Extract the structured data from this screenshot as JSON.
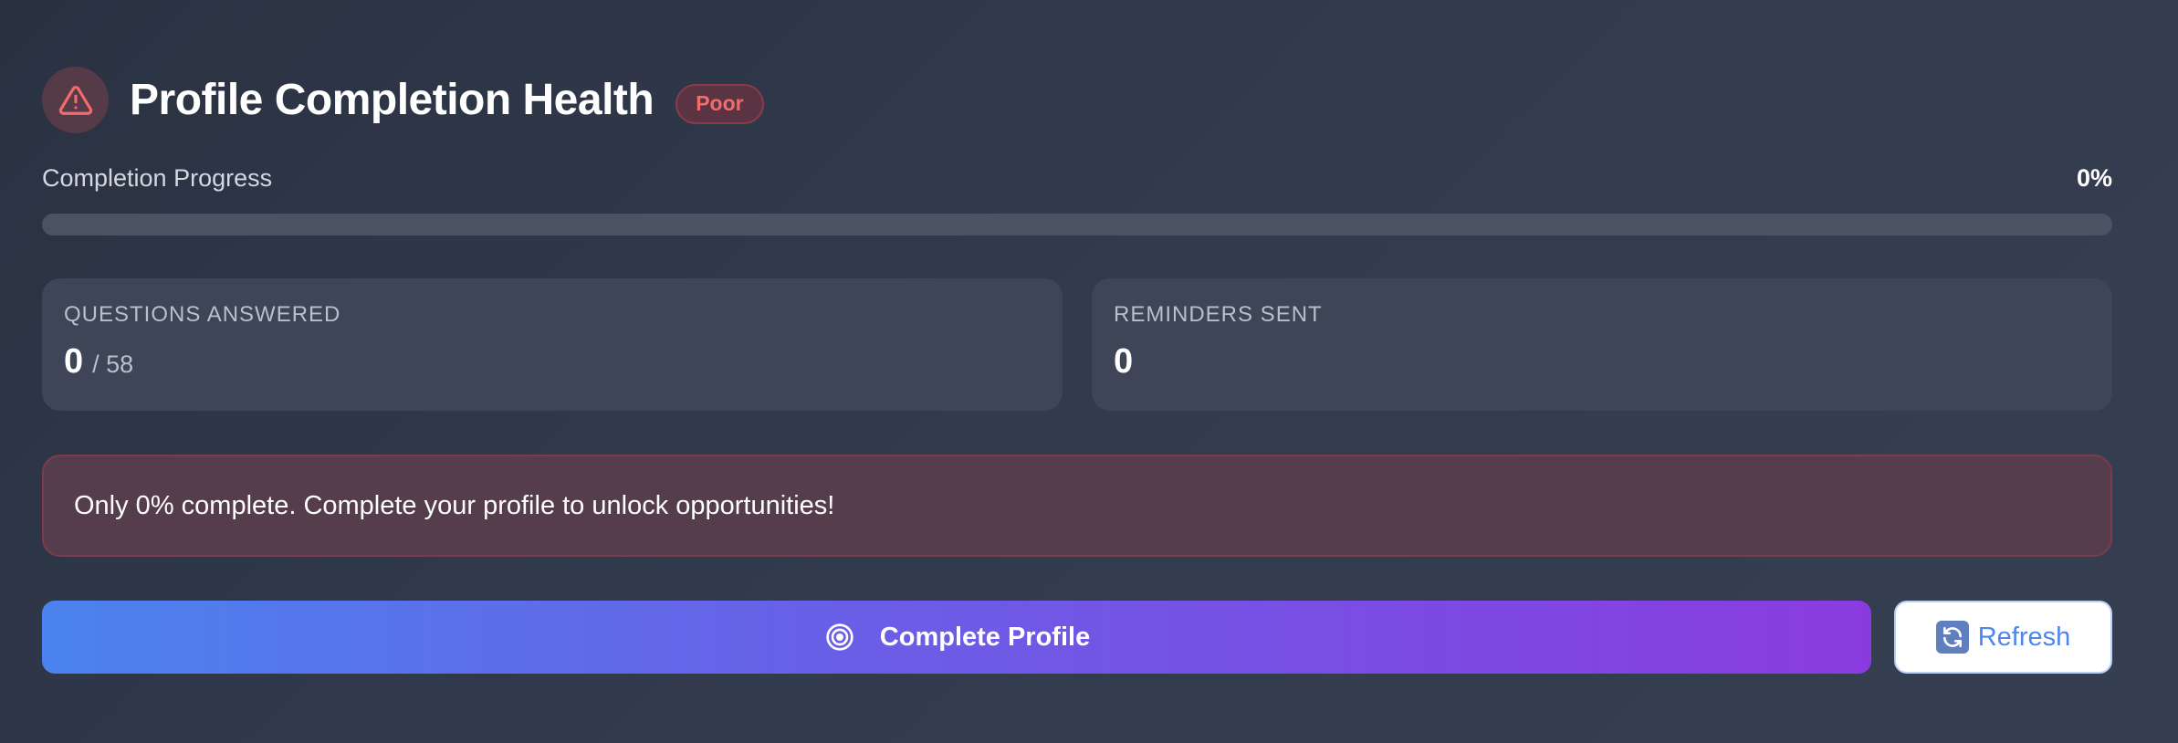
{
  "header": {
    "title": "Profile Completion Health",
    "status_badge": "Poor",
    "alert_icon": "alert-triangle-icon"
  },
  "progress": {
    "label": "Completion Progress",
    "value_text": "0%",
    "value": 0
  },
  "stats": {
    "questions": {
      "label": "QUESTIONS ANSWERED",
      "value": "0",
      "total": "/ 58"
    },
    "reminders": {
      "label": "REMINDERS SENT",
      "value": "0"
    }
  },
  "notice": {
    "text": "Only 0% complete. Complete your profile to unlock opportunities!"
  },
  "actions": {
    "complete_label": "Complete Profile",
    "complete_icon": "target-icon",
    "refresh_label": "Refresh",
    "refresh_icon": "refresh-icon"
  },
  "colors": {
    "accent_start": "#4b83ee",
    "accent_end": "#8a3be0",
    "danger": "#f36c6c"
  }
}
